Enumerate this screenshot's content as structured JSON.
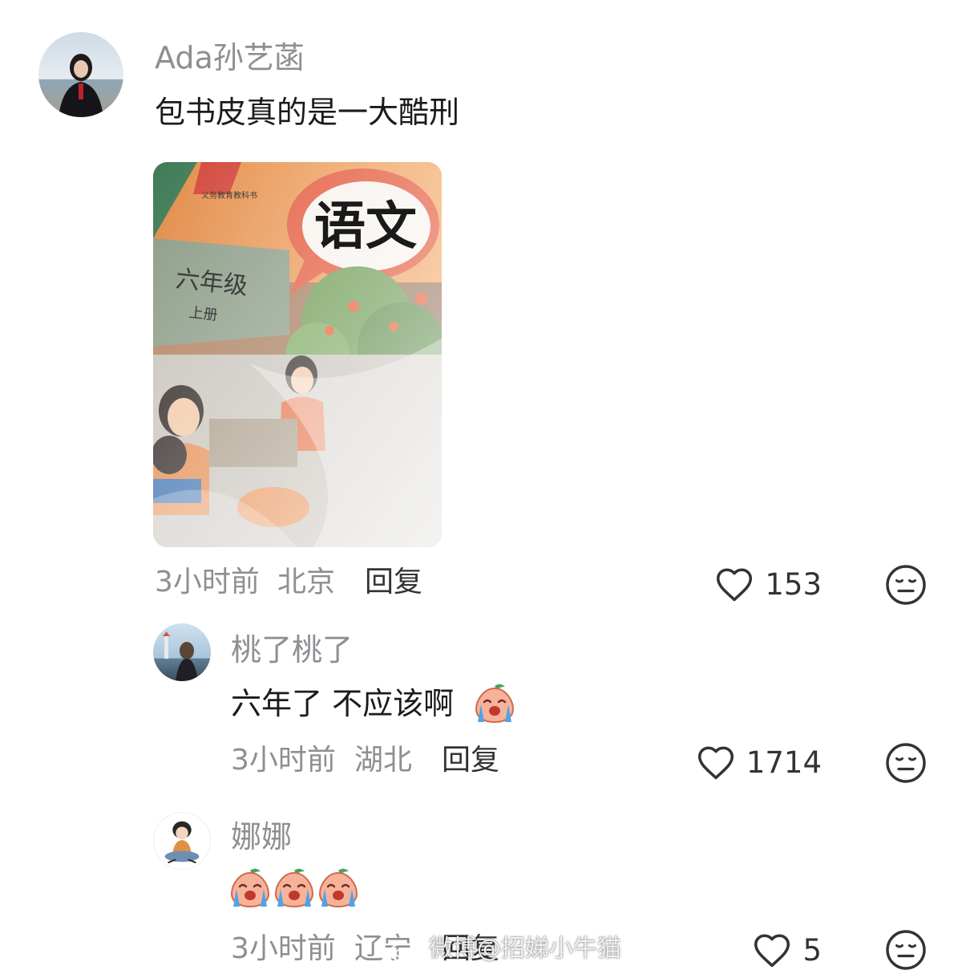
{
  "comments": [
    {
      "username": "Ada孙艺菡",
      "text": "包书皮真的是一大酷刑",
      "time": "3小时前",
      "location": "北京",
      "reply_label": "回复",
      "likes": "153",
      "image": {
        "title_text": "语文",
        "grade_text": "六年级",
        "volume_text": "上册",
        "publisher_text": "义务教育教科书"
      }
    },
    {
      "username": "桃了桃了",
      "text": "六年了 不应该啊",
      "time": "3小时前",
      "location": "湖北",
      "reply_label": "回复",
      "likes": "1714",
      "emoji": "crying-peach-emoji"
    },
    {
      "username": "娜娜",
      "text": "",
      "emojis": [
        "crying-peach-emoji",
        "crying-peach-emoji",
        "crying-peach-emoji"
      ],
      "time": "3小时前",
      "location": "辽宁",
      "reply_label": "回复",
      "likes": "5"
    }
  ],
  "icons": {
    "like": "heart-outline-icon",
    "dislike": "neutral-face-icon"
  },
  "watermark": "微博@招娣小牛猫",
  "colors": {
    "username": "#8e8e93",
    "text": "#1b1b1b",
    "meta": "#8e8e93",
    "icon": "#333333"
  }
}
